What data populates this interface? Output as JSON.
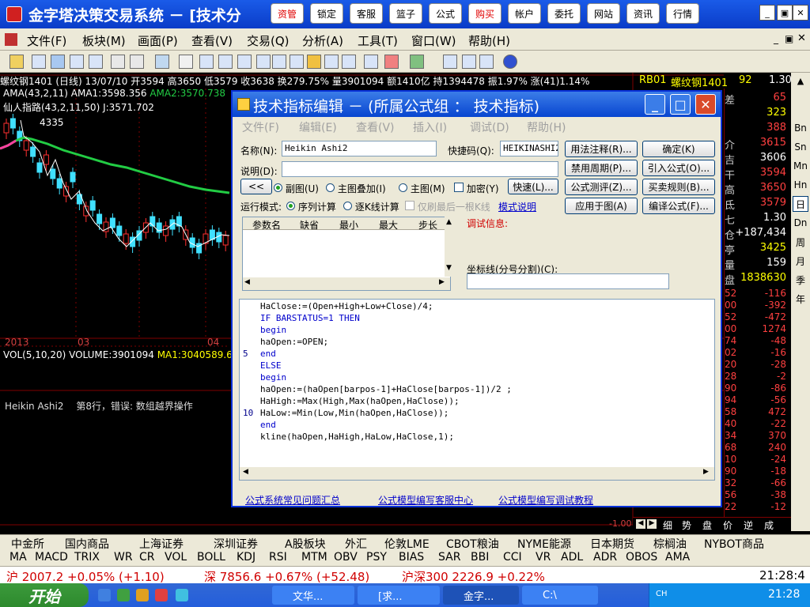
{
  "app": {
    "title": "金字塔决策交易系统 － [技术分",
    "buttons": [
      "资管",
      "锁定",
      "客服",
      "篮子",
      "公式",
      "购买",
      "帐户",
      "委托",
      "网站",
      "资讯",
      "行情"
    ]
  },
  "menu": [
    "文件(F)",
    "板块(M)",
    "画面(P)",
    "查看(V)",
    "交易(Q)",
    "分析(A)",
    "工具(T)",
    "窗口(W)",
    "帮助(H)"
  ],
  "chart": {
    "info": "螺纹钢1401 (日线) 13/07/10 开3594 高3650 低3579 收3638 换279.75% 量3901094 额1410亿 持1394478 振1.97% 涨(41)1.14%",
    "ama_label": "AMA(43,2,11)",
    "ama1": "AMA1:3598.356",
    "ama2": "AMA2:3570.738",
    "xrzb": "仙人指路(43,2,11,50) J:3571.702",
    "peak_label": "4335",
    "axis_labels": [
      "2013",
      "03",
      "04"
    ],
    "vol": "VOL(5,10,20) VOLUME:3901094",
    "ma1": "MA1:3040589.6",
    "sub_label": "Heikin Ashi2",
    "sub_error": "第8行，错误: 数组越界操作",
    "scale_right": "-1.00"
  },
  "quote": {
    "code": "RB01",
    "name": "螺纹钢1401",
    "val": "92",
    "top_val": "1.30",
    "rows": [
      {
        "l": "差",
        "v": "65",
        "c": "#ff4040"
      },
      {
        "l": "",
        "v": "323",
        "c": "#ffff00"
      },
      {
        "l": "",
        "v": "388",
        "c": "#ff4040"
      },
      {
        "l": "介",
        "v": "3615",
        "c": "#ff4040"
      },
      {
        "l": "吉",
        "v": "3606",
        "c": "#ffffff"
      },
      {
        "l": "干",
        "v": "3594",
        "c": "#ff4040"
      },
      {
        "l": "高",
        "v": "3650",
        "c": "#ff4040"
      },
      {
        "l": "氐",
        "v": "3579",
        "c": "#ff4040"
      },
      {
        "l": "七",
        "v": "1.30",
        "c": "#ffffff"
      },
      {
        "l": "仓",
        "v": "+187,434",
        "c": "#ffffff"
      },
      {
        "l": "亭",
        "v": "3425",
        "c": "#ffff00"
      },
      {
        "l": "量",
        "v": "159",
        "c": "#ffffff"
      },
      {
        "l": "盘",
        "v": "1838630",
        "c": "#ffff00"
      }
    ],
    "ticks": [
      {
        "a": "52",
        "v": "-116"
      },
      {
        "a": "00",
        "v": "-392"
      },
      {
        "a": "52",
        "v": "-472"
      },
      {
        "a": "00",
        "v": "1274"
      },
      {
        "a": "74",
        "v": "-48"
      },
      {
        "a": "02",
        "v": "-16"
      },
      {
        "a": "20",
        "v": "-28"
      },
      {
        "a": "28",
        "v": "-2"
      },
      {
        "a": "90",
        "v": "-86"
      },
      {
        "a": "94",
        "v": "-56"
      },
      {
        "a": "58",
        "v": "472"
      },
      {
        "a": "40",
        "v": "-22"
      },
      {
        "a": "34",
        "v": "370"
      },
      {
        "a": "68",
        "v": "240"
      },
      {
        "a": "10",
        "v": "-24"
      },
      {
        "a": "90",
        "v": "-18"
      },
      {
        "a": "32",
        "v": "-66"
      },
      {
        "a": "56",
        "v": "-38"
      },
      {
        "a": "22",
        "v": "-12"
      }
    ],
    "tabs": [
      "细",
      "势",
      "盘",
      "价",
      "逆",
      "成"
    ]
  },
  "periods": [
    "Bn",
    "Sn",
    "Mn",
    "Hn",
    "日",
    "Dn",
    "周",
    "月",
    "季",
    "年"
  ],
  "dialog": {
    "title": "技术指标编辑 － (所属公式组 ： 技术指标)",
    "menu": [
      "文件(F)",
      "编辑(E)",
      "查看(V)",
      "插入(I)",
      "调试(D)",
      "帮助(H)"
    ],
    "name_label": "名称(N):",
    "name_value": "Heikin Ashi2",
    "code_label": "快捷码(Q):",
    "code_value": "HEIKINASHI2",
    "desc_label": "说明(D):",
    "desc_value": "",
    "back_btn": "<<",
    "radio_sub": "副图(U)",
    "radio_overlay": "主图叠加(I)",
    "radio_main": "主图(M)",
    "encrypt": "加密(Y)",
    "quick_btn": "快速(L)...",
    "run_mode": "运行模式:",
    "seq_calc": "序列计算",
    "tick_calc": "逐K线计算",
    "last_only": "仅刷最后一根K线",
    "mode_link": "模式说明",
    "params_headers": [
      "参数名",
      "缺省",
      "最小",
      "最大",
      "步长"
    ],
    "debug_label": "调试信息:",
    "coord_label": "坐标线(分号分割)(C):",
    "coord_value": "",
    "buttons": [
      "用法注释(R)...",
      "确定(K)",
      "禁用周期(P)...",
      "引入公式(O)...",
      "公式测评(Z)...",
      "买卖规则(B)...",
      "应用于图(A)",
      "编译公式(F)..."
    ],
    "code_lines": [
      "HaClose:=(Open+High+Low+Close)/4;",
      "IF BARSTATUS=1 THEN",
      "begin",
      "haOpen:=OPEN;",
      "end",
      "ELSE",
      "begin",
      "haOpen:=(haOpen[barpos-1]+HaClose[barpos-1])/2 ;",
      "HaHigh:=Max(High,Max(haOpen,HaClose));",
      "HaLow:=Min(Low,Min(haOpen,HaClose));",
      "end",
      "kline(haOpen,HaHigh,HaLow,HaClose,1);"
    ],
    "line_numbers": [
      "5",
      "10"
    ],
    "links": [
      "公式系统常见问题汇总",
      "公式模型编写客服中心",
      "公式模型编写调试教程"
    ]
  },
  "markets": [
    "中金所",
    "国内商品",
    "上海证券",
    "深圳证券",
    "A股板块",
    "外汇",
    "伦敦LME",
    "CBOT粮油",
    "NYME能源",
    "日本期货",
    "棕榈油",
    "NYBOT商品"
  ],
  "indicators": [
    "MA",
    "MACD",
    "TRIX",
    "WR",
    "CR",
    "VOL",
    "BOLL",
    "KDJ",
    "RSI",
    "MTM",
    "OBV",
    "PSY",
    "BIAS",
    "SAR",
    "BBI",
    "CCI",
    "VR",
    "ADL",
    "ADR",
    "OBOS",
    "AMA"
  ],
  "indices": {
    "sh": "沪 2007.2 +0.05% (+1.10)",
    "sz": "深 7856.6 +0.67% (+52.48)",
    "hs300": "沪深300  2226.9 +0.22%",
    "time": "21:28:4"
  },
  "taskbar": {
    "start": "开始",
    "tasks": [
      "文华...",
      "[求...",
      "金字...",
      "C:\\"
    ],
    "clock": "21:28",
    "lang": "CH"
  }
}
